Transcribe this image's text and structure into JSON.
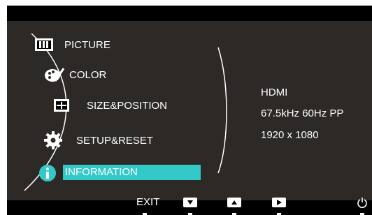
{
  "menu": {
    "items": [
      {
        "label": "PICTURE",
        "icon": "picture-icon"
      },
      {
        "label": "COLOR",
        "icon": "color-palette-icon"
      },
      {
        "label": "SIZE&POSITION",
        "icon": "size-position-icon"
      },
      {
        "label": "SETUP&RESET",
        "icon": "gear-icon"
      },
      {
        "label": "INFORMATION",
        "icon": "info-icon"
      }
    ],
    "selected_index": 4,
    "highlight_color": "#34c9c9"
  },
  "info": {
    "source": "HDMI",
    "frequency": "67.5kHz 60Hz PP",
    "resolution": "1920 x 1080"
  },
  "footer": {
    "exit_label": "EXIT",
    "buttons": [
      "down-arrow-icon",
      "up-arrow-icon",
      "right-arrow-icon",
      "power-icon"
    ]
  },
  "colors": {
    "panel_bg": "#2d2926",
    "frame_bg": "#000000"
  }
}
